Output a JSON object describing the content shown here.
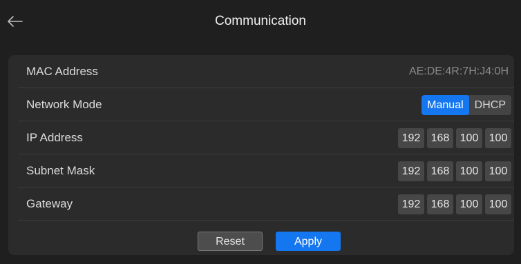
{
  "header": {
    "title": "Communication",
    "back_icon": "arrow-left-icon"
  },
  "rows": {
    "mac": {
      "label": "MAC Address",
      "value": "AE:DE:4R:7H:J4:0H"
    },
    "network_mode": {
      "label": "Network Mode",
      "options": [
        "Manual",
        "DHCP"
      ],
      "selected": "Manual"
    },
    "ip": {
      "label": "IP Address",
      "octets": [
        "192",
        "168",
        "100",
        "100"
      ]
    },
    "subnet": {
      "label": "Subnet Mask",
      "octets": [
        "192",
        "168",
        "100",
        "100"
      ]
    },
    "gateway": {
      "label": "Gateway",
      "octets": [
        "192",
        "168",
        "100",
        "100"
      ]
    }
  },
  "actions": {
    "reset_label": "Reset",
    "apply_label": "Apply"
  },
  "colors": {
    "accent": "#1577f0",
    "background": "#1f1f1f",
    "panel": "#2b2b2b",
    "field": "#474747"
  }
}
